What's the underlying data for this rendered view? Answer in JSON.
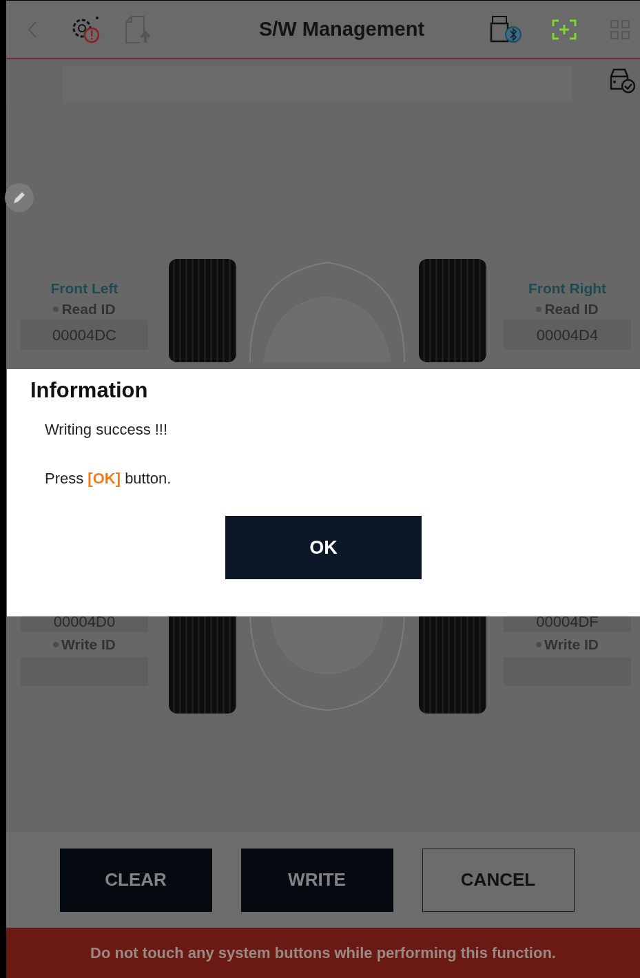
{
  "header": {
    "title": "S/W Management"
  },
  "front": [
    {
      "name": "Front Left",
      "read_label": "Read ID",
      "read_value": "00004DC"
    },
    {
      "name": "Front Right",
      "read_label": "Read ID",
      "read_value": "00004D4"
    }
  ],
  "rear": [
    {
      "value": "00004D0",
      "write_label": "Write ID"
    },
    {
      "value": "00004DF",
      "write_label": "Write ID"
    }
  ],
  "dialog": {
    "title": "Information",
    "lines": [
      "Writing success !!!",
      "Press **[OK]** button."
    ],
    "button": "OK"
  },
  "buttons": [
    {
      "label": "CLEAR",
      "kind": "filled"
    },
    {
      "label": "WRITE",
      "kind": "filled"
    },
    {
      "label": "CANCEL",
      "kind": "outline"
    }
  ],
  "warning": "Do not touch any system buttons while performing this function."
}
